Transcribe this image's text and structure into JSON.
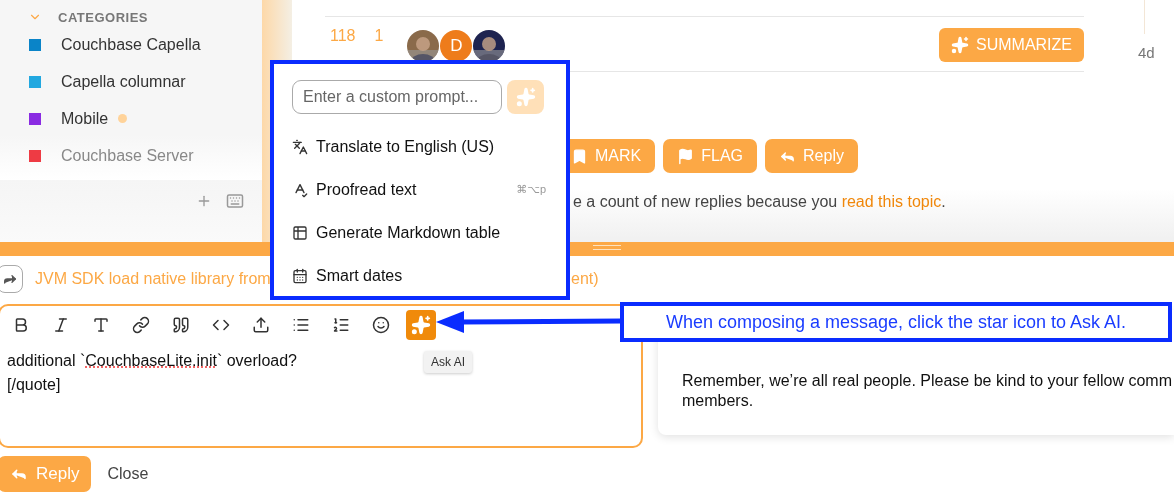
{
  "sidebar": {
    "section_title": "CATEGORIES",
    "expanded": true,
    "categories": [
      {
        "name": "Couchbase Capella",
        "color": "#0a84c8",
        "unread": false
      },
      {
        "name": "Capella columnar",
        "color": "#22a8e0",
        "unread": false
      },
      {
        "name": "Mobile",
        "color": "#8a2be2",
        "unread": true
      },
      {
        "name": "Couchbase Server",
        "color": "#ee3b44",
        "unread": false
      }
    ]
  },
  "topic": {
    "stats": [
      {
        "value": "118"
      },
      {
        "value": "1"
      }
    ],
    "participants": [
      {
        "kind": "picture",
        "color": "#8a6a4a"
      },
      {
        "kind": "letter",
        "letter": "D",
        "color": "#ee7c1b"
      },
      {
        "kind": "picture",
        "color": "#1e2350"
      }
    ],
    "summarize_button": "SUMMARIZE",
    "age": "4d",
    "actions": [
      {
        "kind": "bookmark",
        "label": "MARK"
      },
      {
        "kind": "flag",
        "label": "FLAG"
      },
      {
        "kind": "reply",
        "label": "Reply"
      }
    ],
    "notice": {
      "text": "e a count of new replies because you ",
      "link": "read this topic",
      "end": "."
    }
  },
  "composer": {
    "reply_to": "JVM SDK load native library from",
    "reply_to_tail": "ent)",
    "toolbar": [
      {
        "kind": "bold",
        "selected": false
      },
      {
        "kind": "italic",
        "selected": false
      },
      {
        "kind": "heading",
        "selected": false
      },
      {
        "kind": "link",
        "selected": false
      },
      {
        "kind": "quote",
        "selected": false
      },
      {
        "kind": "code",
        "selected": false
      },
      {
        "kind": "upload",
        "selected": false
      },
      {
        "kind": "bullets",
        "selected": false
      },
      {
        "kind": "numbers",
        "selected": false
      },
      {
        "kind": "emoji",
        "selected": false
      },
      {
        "kind": "ai",
        "selected": true
      }
    ],
    "lines": [
      [
        {
          "text": "additional `",
          "misspelled": false
        },
        {
          "text": "CouchbaseLite.init",
          "misspelled": true
        },
        {
          "text": "` overload?",
          "misspelled": false
        }
      ],
      [
        {
          "text": "[/quote]",
          "misspelled": false
        }
      ]
    ],
    "tooltip": "Ask AI",
    "submit": "Reply",
    "close": "Close"
  },
  "preview": {
    "lines": [
      "Remember, we’re all real people. Please be kind to your fellow comm",
      "members."
    ]
  },
  "ai_menu": {
    "placeholder": "Enter a custom prompt...",
    "items": [
      {
        "kind": "translate",
        "label": "Translate to English (US)"
      },
      {
        "kind": "proofread",
        "label": "Proofread text",
        "shortcut": "⌘⌥p"
      },
      {
        "kind": "table",
        "label": "Generate Markdown table"
      },
      {
        "kind": "calendar",
        "label": "Smart dates"
      }
    ]
  },
  "callout": {
    "text": "When composing a message, click the star icon to Ask AI."
  }
}
